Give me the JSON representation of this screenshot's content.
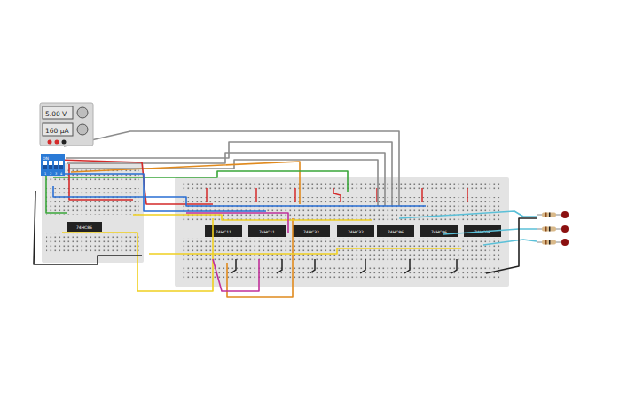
{
  "power_supply": {
    "voltage": "5.00 V",
    "current": "160 µA"
  },
  "dip_switch": {
    "label": "ON",
    "switches": [
      {
        "label": "1",
        "on": true
      },
      {
        "label": "2",
        "on": true
      },
      {
        "label": "3",
        "on": true
      },
      {
        "label": "4",
        "on": true
      }
    ]
  },
  "chips": [
    {
      "label": "74HC86"
    },
    {
      "label": "74HC11"
    },
    {
      "label": "74HC11"
    },
    {
      "label": "74HC32"
    },
    {
      "label": "74HC32"
    },
    {
      "label": "74HC86"
    },
    {
      "label": "74HC86"
    },
    {
      "label": "74HC08"
    }
  ],
  "leds": [
    {
      "on": false,
      "color": "#8b1010"
    },
    {
      "on": false,
      "color": "#8b1010"
    },
    {
      "on": false,
      "color": "#8b1010"
    }
  ],
  "wires": [
    {
      "color": "#8c8c8c"
    },
    {
      "color": "#8c8c8c"
    },
    {
      "color": "#8c8c8c"
    },
    {
      "color": "#8c8c8c"
    },
    {
      "color": "#e08a1e"
    },
    {
      "color": "#e08a1e"
    },
    {
      "color": "#3aa63a"
    },
    {
      "color": "#3aa63a"
    },
    {
      "color": "#d42a2a"
    },
    {
      "color": "#d42a2a"
    },
    {
      "color": "#2a6fd4"
    },
    {
      "color": "#2a6fd4"
    },
    {
      "color": "#f0d020"
    },
    {
      "color": "#f0d020"
    },
    {
      "color": "#f0d020"
    },
    {
      "color": "#5bc0d8"
    },
    {
      "color": "#5bc0d8"
    },
    {
      "color": "#5bc0d8"
    },
    {
      "color": "#c0309a"
    },
    {
      "color": "#c0309a"
    },
    {
      "color": "#222222"
    },
    {
      "color": "#222222"
    }
  ]
}
